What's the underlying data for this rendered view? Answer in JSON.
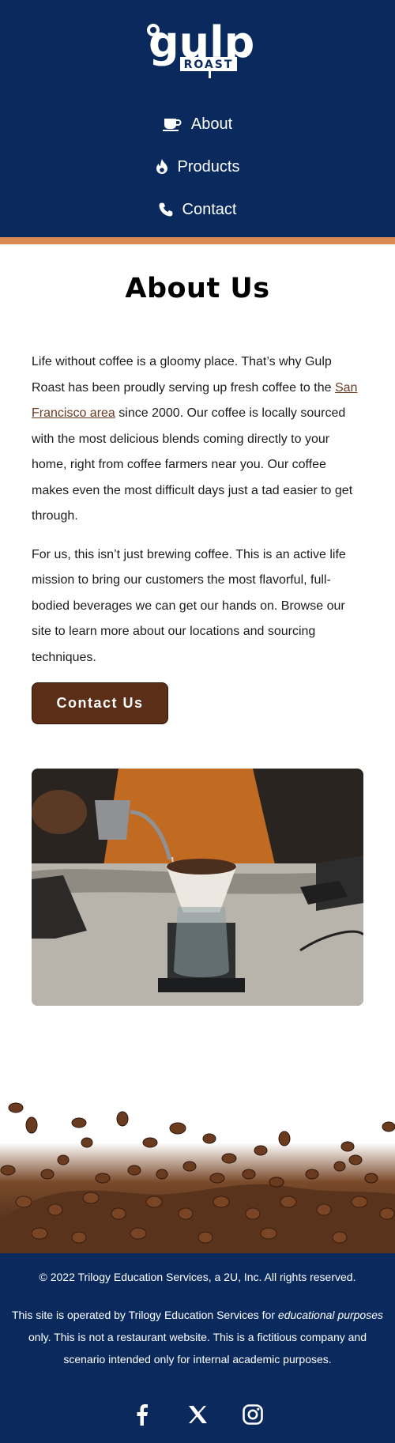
{
  "brand": {
    "logo_word": "gulp",
    "logo_sub": "ROAST"
  },
  "colors": {
    "navy": "#0a2a5e",
    "accent_bar": "#d98a52",
    "button_brown": "#5b2f17",
    "link_brown": "#6b3b22"
  },
  "nav": {
    "items": [
      {
        "label": "About",
        "icon": "coffee-cup-icon"
      },
      {
        "label": "Products",
        "icon": "fire-icon"
      },
      {
        "label": "Contact",
        "icon": "phone-icon"
      }
    ]
  },
  "about": {
    "title": "About Us",
    "p1_before": "Life without coffee is a gloomy place. That’s why Gulp Roast has been proudly serving up fresh coffee to the ",
    "p1_link": "San Francisco area",
    "p1_after": " since 2000. Our coffee is locally sourced with the most delicious blends coming directly to your home, right from coffee farmers near you. Our coffee makes even the most difficult days just a tad easier to get through.",
    "p2": "For us, this isn’t just brewing coffee. This is an active life mission to bring our customers the most flavorful, full-bodied beverages we can get our hands on. Browse our site to learn more about our locations and sourcing techniques.",
    "button_label": "Contact Us"
  },
  "footer": {
    "copyright": "© 2022 Trilogy Education Services, a 2U, Inc. All rights reserved.",
    "notice_before": "This site is operated by Trilogy Education Services for ",
    "notice_em": "educational purposes",
    "notice_after": " only. This is not a restaurant website. This is a fictitious company and scenario intended only for internal academic purposes.",
    "socials": [
      "facebook-icon",
      "x-icon",
      "instagram-icon"
    ]
  }
}
